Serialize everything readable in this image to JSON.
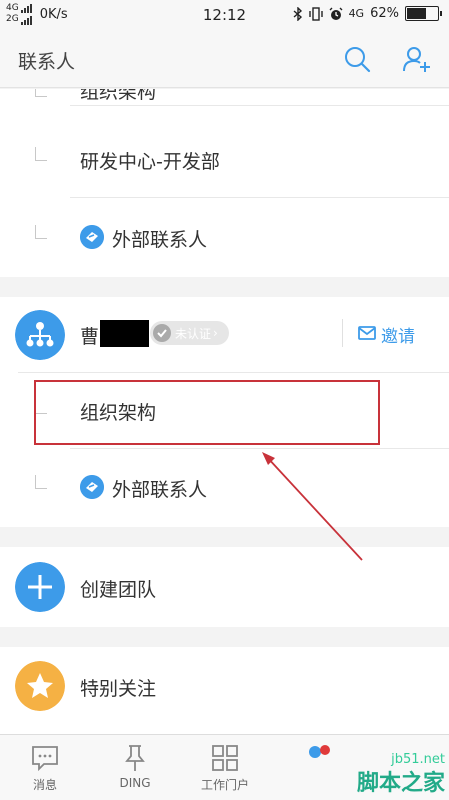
{
  "status_bar": {
    "network_top": "4G",
    "network_bottom": "2G",
    "speed": "0K/s",
    "time": "12:12",
    "network_right": "4G",
    "battery": "62%",
    "battery_level": 0.62
  },
  "header": {
    "title": "联系人",
    "icons": [
      "search-icon",
      "add-contact-icon"
    ]
  },
  "list": {
    "partial_item": "组织架构",
    "dept_item": "研发中心-开发部",
    "external_1": "外部联系人",
    "org": {
      "name_prefix": "曹",
      "unverified_badge": "未认证",
      "invite_label": "邀请"
    },
    "org_structure": "组织架构",
    "external_2": "外部联系人",
    "create_team": "创建团队",
    "special_follow": "特别关注"
  },
  "bottom_nav": {
    "items": [
      {
        "label": "消息",
        "icon": "message-icon"
      },
      {
        "label": "DING",
        "icon": "pin-icon"
      },
      {
        "label": "工作门户",
        "icon": "grid-icon"
      },
      {
        "label": "",
        "icon": "contacts-icon"
      }
    ]
  },
  "watermark": {
    "url": "jb51.net",
    "text": "脚本之家"
  },
  "colors": {
    "accent": "#3d9be9",
    "highlight": "#c8323a",
    "star": "#f5b144"
  }
}
